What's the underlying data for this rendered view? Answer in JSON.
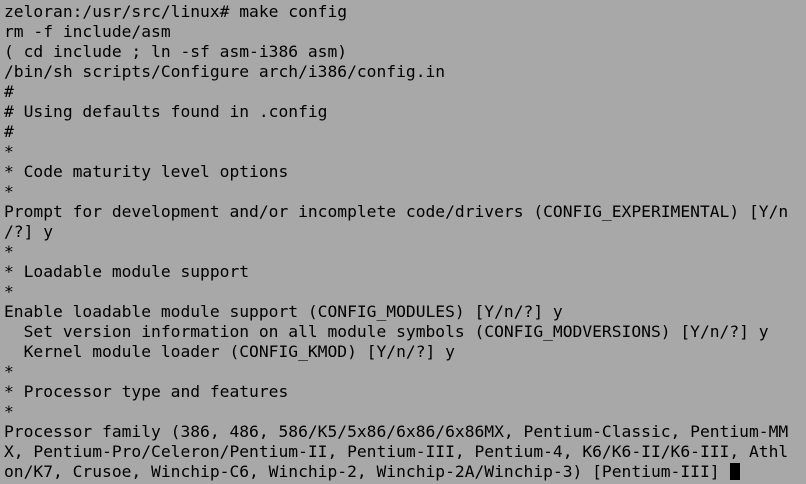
{
  "terminal": {
    "background": "#a8a8a8",
    "foreground": "#000000",
    "lines": [
      "zeloran:/usr/src/linux# make config",
      "rm -f include/asm",
      "( cd include ; ln -sf asm-i386 asm)",
      "/bin/sh scripts/Configure arch/i386/config.in",
      "#",
      "# Using defaults found in .config",
      "#",
      "*",
      "* Code maturity level options",
      "*",
      "Prompt for development and/or incomplete code/drivers (CONFIG_EXPERIMENTAL) [Y/n",
      "/?] y",
      "*",
      "* Loadable module support",
      "*",
      "Enable loadable module support (CONFIG_MODULES) [Y/n/?] y",
      "  Set version information on all module symbols (CONFIG_MODVERSIONS) [Y/n/?] y",
      "  Kernel module loader (CONFIG_KMOD) [Y/n/?] y",
      "*",
      "* Processor type and features",
      "*",
      "Processor family (386, 486, 586/K5/5x86/6x86/6x86MX, Pentium-Classic, Pentium-MM",
      "X, Pentium-Pro/Celeron/Pentium-II, Pentium-III, Pentium-4, K6/K6-II/K6-III, Athl"
    ],
    "prompt_line": "on/K7, Crusoe, Winchip-C6, Winchip-2, Winchip-2A/Winchip-3) [Pentium-III] ",
    "cursor_icon": "block-cursor-icon"
  }
}
